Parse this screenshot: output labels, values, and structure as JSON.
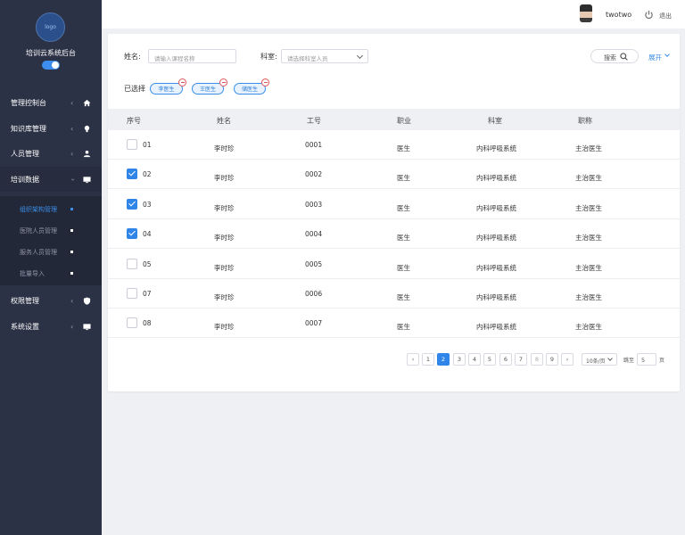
{
  "app": {
    "logo_text": "logo",
    "name": "培训云系统后台"
  },
  "header": {
    "username": "twotwo",
    "logout": "退出"
  },
  "sidebar": {
    "items": [
      {
        "label": "管理控制台",
        "icon": "home-icon"
      },
      {
        "label": "知识库管理",
        "icon": "bulb-icon"
      },
      {
        "label": "人员管理",
        "icon": "users-icon"
      },
      {
        "label": "培训数据",
        "icon": "monitor-icon"
      },
      {
        "label": "权限管理",
        "icon": "shield-icon"
      },
      {
        "label": "系统设置",
        "icon": "monitor-icon"
      }
    ],
    "sub_items": [
      {
        "label": "组织架构管理",
        "active": true
      },
      {
        "label": "医院人员管理"
      },
      {
        "label": "服务人员管理"
      },
      {
        "label": "批量导入"
      }
    ]
  },
  "filters": {
    "name_label": "姓名:",
    "name_placeholder": "请输入课程名称",
    "dept_label": "科室:",
    "dept_placeholder": "请选择科室人员",
    "search": "搜索",
    "expand": "展开"
  },
  "selected": {
    "label": "已选择",
    "tags": [
      "李医生",
      "王医生",
      "储医生"
    ]
  },
  "table": {
    "headers": [
      "序号",
      "姓名",
      "工号",
      "职业",
      "科室",
      "职称"
    ],
    "rows": [
      {
        "no": "01",
        "name": "李时珍",
        "id": "0001",
        "job": "医生",
        "dept": "内科呼吸系统",
        "title": "主治医生",
        "checked": false
      },
      {
        "no": "02",
        "name": "李时珍",
        "id": "0002",
        "job": "医生",
        "dept": "内科呼吸系统",
        "title": "主治医生",
        "checked": true
      },
      {
        "no": "03",
        "name": "李时珍",
        "id": "0003",
        "job": "医生",
        "dept": "内科呼吸系统",
        "title": "主治医生",
        "checked": true
      },
      {
        "no": "04",
        "name": "李时珍",
        "id": "0004",
        "job": "医生",
        "dept": "内科呼吸系统",
        "title": "主治医生",
        "checked": true
      },
      {
        "no": "05",
        "name": "李时珍",
        "id": "0005",
        "job": "医生",
        "dept": "内科呼吸系统",
        "title": "主治医生",
        "checked": false
      },
      {
        "no": "07",
        "name": "李时珍",
        "id": "0006",
        "job": "医生",
        "dept": "内科呼吸系统",
        "title": "主治医生",
        "checked": false
      },
      {
        "no": "08",
        "name": "李时珍",
        "id": "0007",
        "job": "医生",
        "dept": "内科呼吸系统",
        "title": "主治医生",
        "checked": false
      }
    ]
  },
  "pagination": {
    "prev": "‹",
    "next": "›",
    "pages": [
      "1",
      "2",
      "3",
      "4",
      "5",
      "6",
      "7",
      "8",
      "9"
    ],
    "current": "2",
    "page_size": "10条/页",
    "goto_label": "跳至",
    "goto_value": "5",
    "page_unit": "页"
  },
  "colors": {
    "accent": "#2f86e8",
    "sidebar_bg": "#2b3245"
  }
}
